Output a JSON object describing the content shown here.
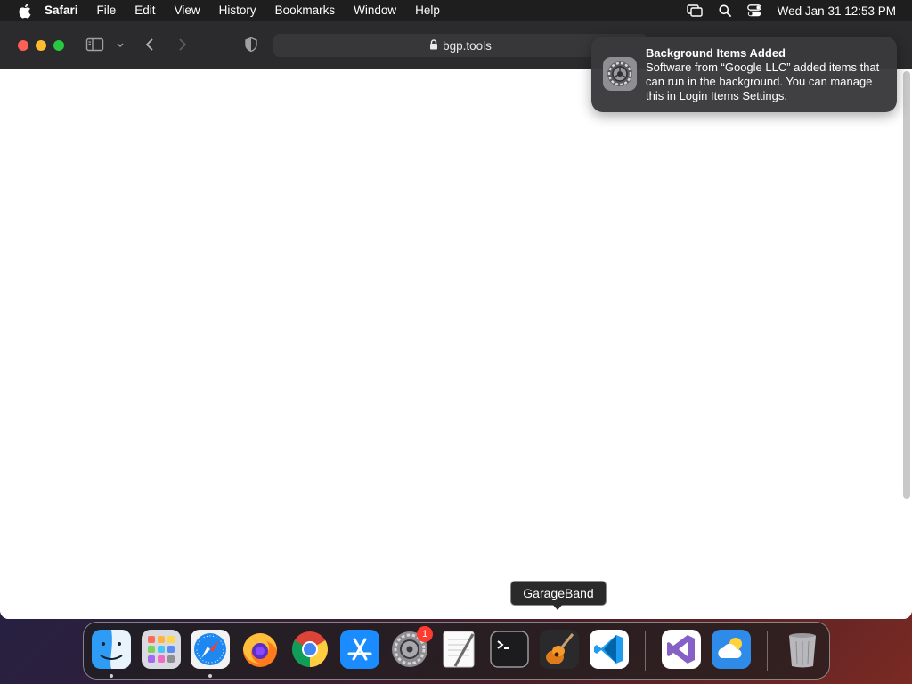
{
  "menubar": {
    "app_name": "Safari",
    "items": [
      "File",
      "Edit",
      "View",
      "History",
      "Bookmarks",
      "Window",
      "Help"
    ],
    "clock": "Wed Jan 31  12:53 PM"
  },
  "browser": {
    "url": "bgp.tools"
  },
  "notification": {
    "title": "Background Items Added",
    "body": "Software from “Google LLC” added items that can run in the background. You can manage this in Login Items Settings."
  },
  "tooltip": {
    "label": "GarageBand"
  },
  "dock": {
    "system_settings_badge": "1"
  },
  "colors": {
    "close": "#ff5f57",
    "minimize": "#febc2e",
    "maximize": "#28c840",
    "badge": "#ff3b30"
  }
}
